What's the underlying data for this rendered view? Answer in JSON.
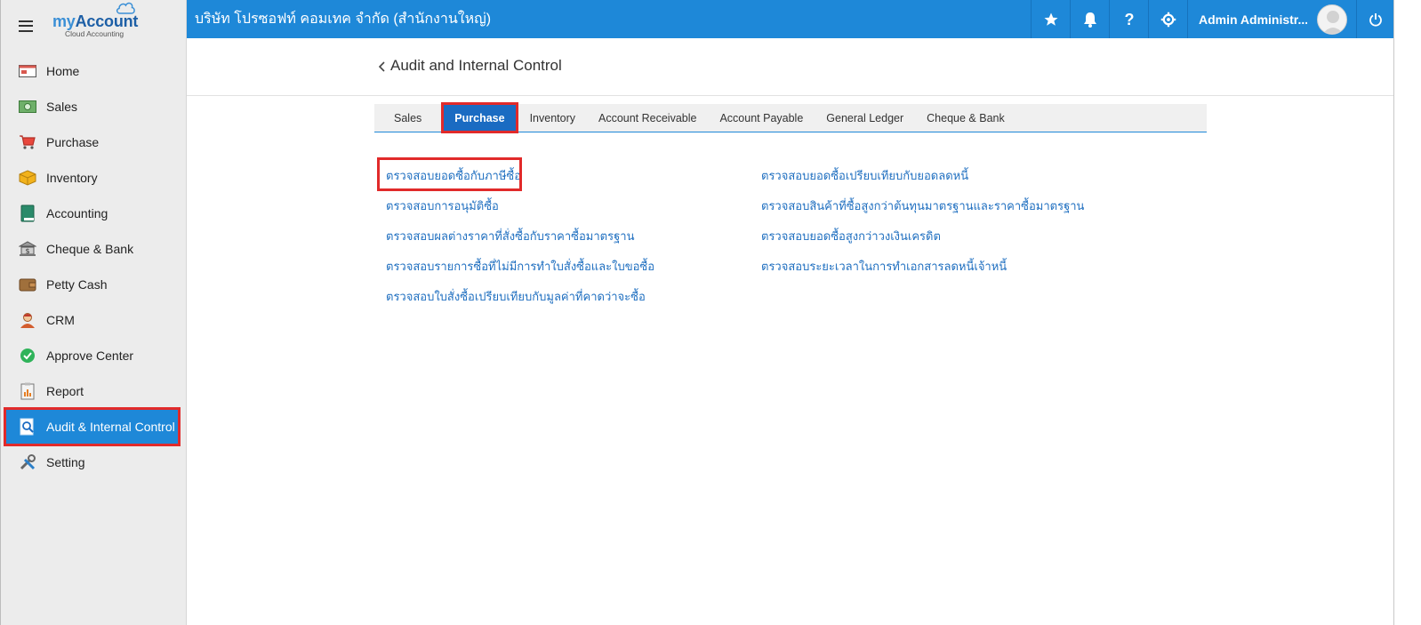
{
  "brand": {
    "logo_my": "my",
    "logo_account": "Account",
    "logo_sub": "Cloud Accounting"
  },
  "sidebar": {
    "items": [
      {
        "label": "Home",
        "icon": "home-icon"
      },
      {
        "label": "Sales",
        "icon": "money-icon"
      },
      {
        "label": "Purchase",
        "icon": "cart-icon"
      },
      {
        "label": "Inventory",
        "icon": "box-icon"
      },
      {
        "label": "Accounting",
        "icon": "book-icon"
      },
      {
        "label": "Cheque & Bank",
        "icon": "bank-icon"
      },
      {
        "label": "Petty Cash",
        "icon": "wallet-icon"
      },
      {
        "label": "CRM",
        "icon": "person-icon"
      },
      {
        "label": "Approve Center",
        "icon": "check-circle-icon"
      },
      {
        "label": "Report",
        "icon": "report-icon"
      },
      {
        "label": "Audit & Internal Control",
        "icon": "audit-icon"
      },
      {
        "label": "Setting",
        "icon": "tools-icon"
      }
    ],
    "active": "Audit & Internal Control"
  },
  "topbar": {
    "company": "บริษัท โปรซอฟท์ คอมเทค จำกัด (สำนักงานใหญ่)",
    "user": "Admin Administr...",
    "icons": [
      "star-icon",
      "bell-icon",
      "help-icon",
      "gear-icon",
      "power-icon"
    ]
  },
  "page": {
    "title": "Audit and Internal Control"
  },
  "tabs": [
    "Sales",
    "Purchase",
    "Inventory",
    "Account Receivable",
    "Account Payable",
    "General Ledger",
    "Cheque & Bank"
  ],
  "active_tab": "Purchase",
  "links_col1": [
    "ตรวจสอบยอดซื้อกับภาษีซื้อ",
    "ตรวจสอบการอนุมัติซื้อ",
    "ตรวจสอบผลต่างราคาที่สั่งซื้อกับราคาซื้อมาตรฐาน",
    "ตรวจสอบรายการซื้อที่ไม่มีการทำใบสั่งซื้อและใบขอซื้อ",
    "ตรวจสอบใบสั่งซื้อเปรียบเทียบกับมูลค่าที่คาดว่าจะซื้อ"
  ],
  "links_col2": [
    "ตรวจสอบยอดซื้อเปรียบเทียบกับยอดลดหนี้",
    "ตรวจสอบสินค้าที่ซื้อสูงกว่าต้นทุนมาตรฐานและราคาซื้อมาตรฐาน",
    "ตรวจสอบยอดซื้อสูงกว่าวงเงินเครดิต",
    "ตรวจสอบระยะเวลาในการทำเอกสารลดหนี้เจ้าหนี้"
  ],
  "colors": {
    "primary": "#1e88d8",
    "active_tab": "#1a6bc2",
    "highlight": "#e12a2a",
    "link": "#1f6fc0"
  }
}
